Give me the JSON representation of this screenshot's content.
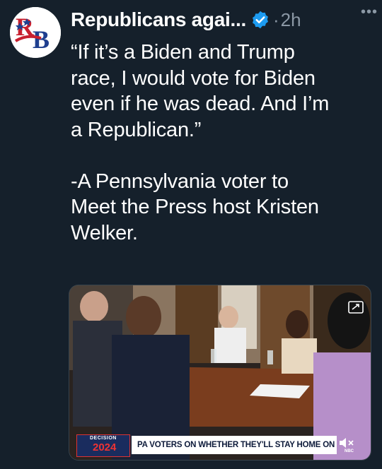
{
  "tweet": {
    "author_name": "Republicans agai...",
    "timestamp": "2h",
    "separator": "·",
    "more_icon": "more-icon",
    "text": "“If it’s a Biden and Trump\nrace, I would vote for Biden\neven if he was dead. And I’m\na Republican.”\n\n-A Pennsylvania voter to\nMeet the Press host Kristen\nWelker."
  },
  "avatar": {
    "letters": "RB",
    "colors": {
      "red": "#c8202f",
      "blue": "#1f3f8f"
    }
  },
  "media": {
    "chyron_logo_small": "DECISION",
    "chyron_logo_year": "2024",
    "chyron_text": "PA VOTERS ON WHETHER THEY'LL STAY HOME ON ELECTION DAY",
    "network": "NBC"
  },
  "colors": {
    "background": "#15202b",
    "verified": "#1d9bf0",
    "secondary_text": "#8b98a5"
  }
}
